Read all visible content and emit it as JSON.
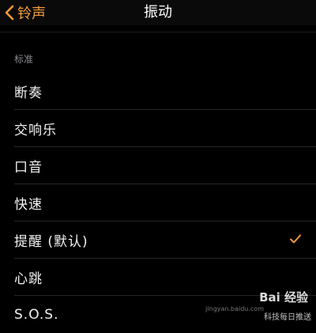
{
  "nav": {
    "back_label": "铃声",
    "title": "振动",
    "accent_color": "#f19a3e"
  },
  "section": {
    "header": "标准",
    "items": [
      {
        "label": "断奏",
        "selected": false
      },
      {
        "label": "交响乐",
        "selected": false
      },
      {
        "label": "口音",
        "selected": false
      },
      {
        "label": "快速",
        "selected": false
      },
      {
        "label": "提醒 (默认)",
        "selected": true
      },
      {
        "label": "心跳",
        "selected": false
      },
      {
        "label": "S.O.S.",
        "selected": false
      }
    ]
  },
  "watermark": {
    "logo": "Bai 经验",
    "sub": "科技每日推送",
    "url": "jingyan.baidu.com"
  }
}
